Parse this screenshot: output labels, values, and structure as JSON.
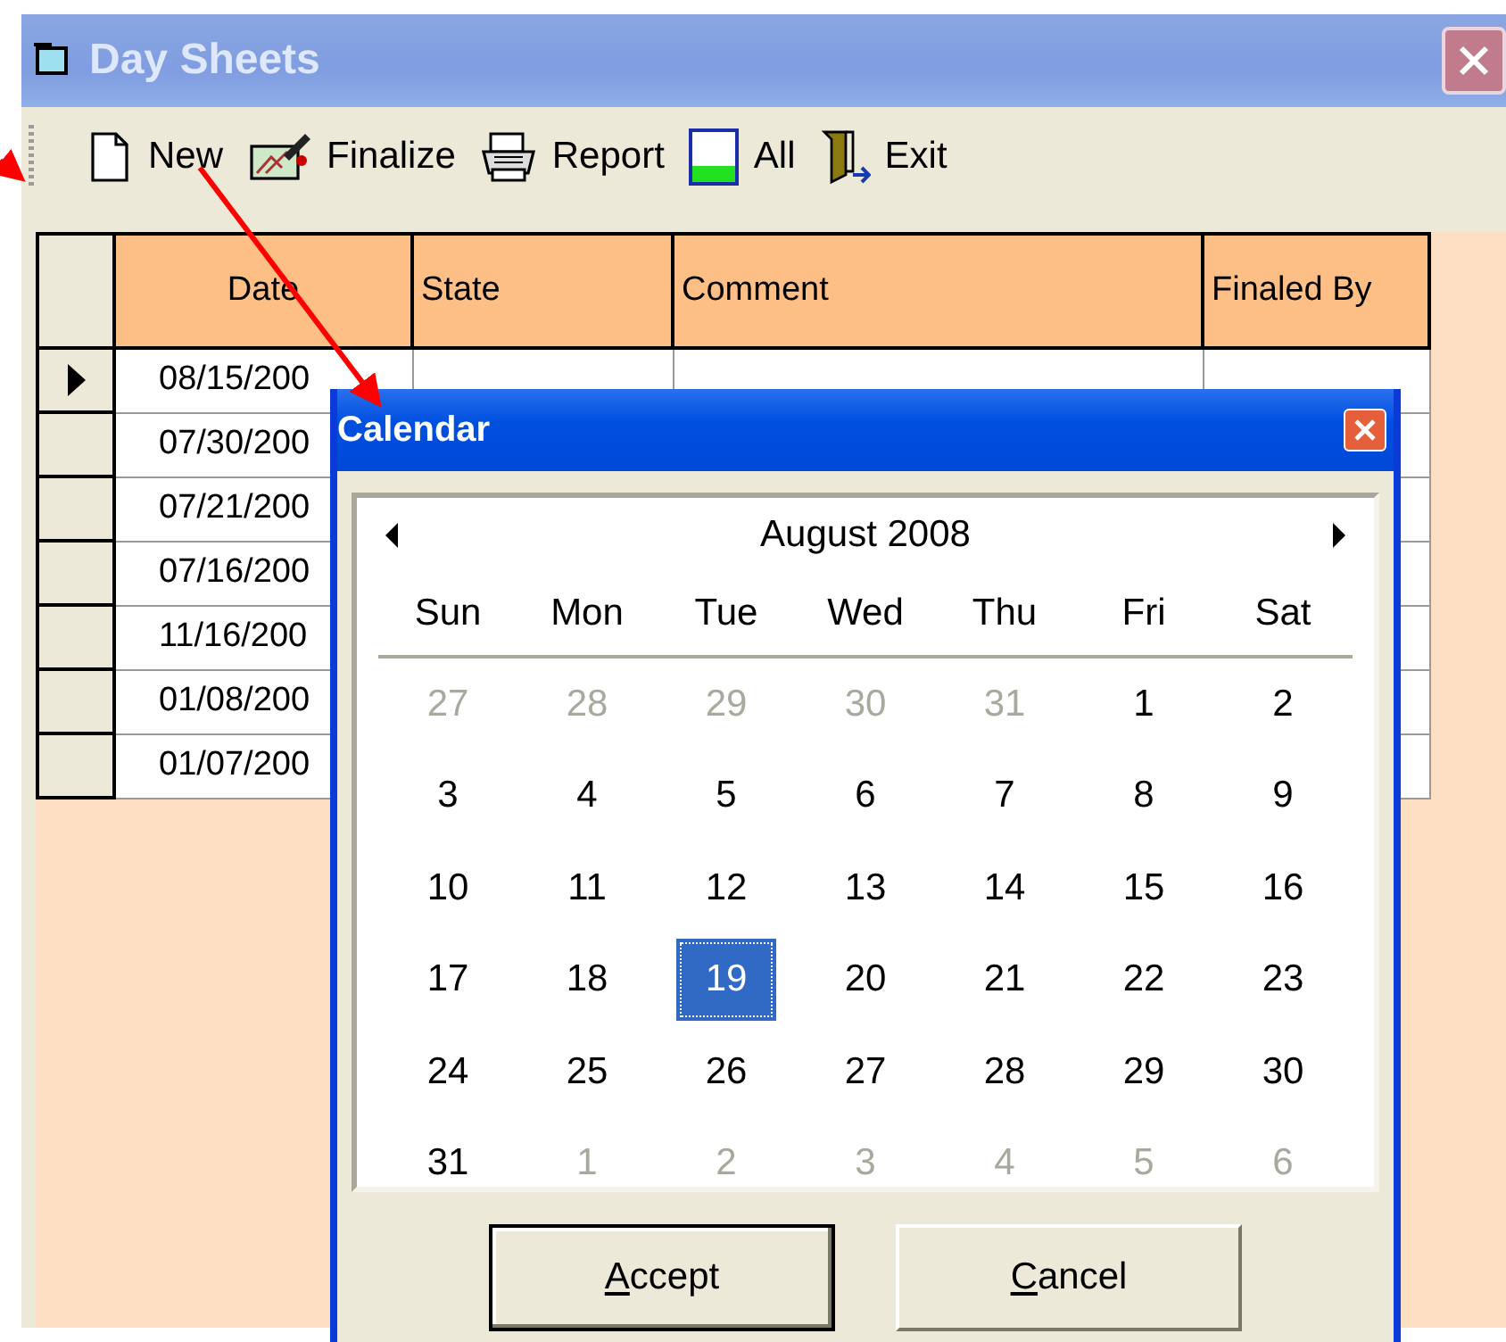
{
  "window": {
    "title": "Day Sheets"
  },
  "toolbar": [
    {
      "kind": "new",
      "label": "New"
    },
    {
      "kind": "finalize",
      "label": "Finalize"
    },
    {
      "kind": "report",
      "label": "Report"
    },
    {
      "kind": "all",
      "label": "All"
    },
    {
      "kind": "exit",
      "label": "Exit"
    }
  ],
  "grid": {
    "columns": [
      "Date",
      "State",
      "Comment",
      "Finaled By"
    ],
    "rows": [
      {
        "current": true,
        "date": "08/15/200"
      },
      {
        "current": false,
        "date": "07/30/200"
      },
      {
        "current": false,
        "date": "07/21/200"
      },
      {
        "current": false,
        "date": "07/16/200"
      },
      {
        "current": false,
        "date": "11/16/200"
      },
      {
        "current": false,
        "date": "01/08/200"
      },
      {
        "current": false,
        "date": "01/07/200"
      }
    ]
  },
  "calendar": {
    "title": "Calendar",
    "month": "August 2008",
    "weekdays": [
      "Sun",
      "Mon",
      "Tue",
      "Wed",
      "Thu",
      "Fri",
      "Sat"
    ],
    "weeks": [
      [
        {
          "day": "27",
          "muted": true,
          "selected": false
        },
        {
          "day": "28",
          "muted": true,
          "selected": false
        },
        {
          "day": "29",
          "muted": true,
          "selected": false
        },
        {
          "day": "30",
          "muted": true,
          "selected": false
        },
        {
          "day": "31",
          "muted": true,
          "selected": false
        },
        {
          "day": "1",
          "muted": false,
          "selected": false
        },
        {
          "day": "2",
          "muted": false,
          "selected": false
        }
      ],
      [
        {
          "day": "3",
          "muted": false,
          "selected": false
        },
        {
          "day": "4",
          "muted": false,
          "selected": false
        },
        {
          "day": "5",
          "muted": false,
          "selected": false
        },
        {
          "day": "6",
          "muted": false,
          "selected": false
        },
        {
          "day": "7",
          "muted": false,
          "selected": false
        },
        {
          "day": "8",
          "muted": false,
          "selected": false
        },
        {
          "day": "9",
          "muted": false,
          "selected": false
        }
      ],
      [
        {
          "day": "10",
          "muted": false,
          "selected": false
        },
        {
          "day": "11",
          "muted": false,
          "selected": false
        },
        {
          "day": "12",
          "muted": false,
          "selected": false
        },
        {
          "day": "13",
          "muted": false,
          "selected": false
        },
        {
          "day": "14",
          "muted": false,
          "selected": false
        },
        {
          "day": "15",
          "muted": false,
          "selected": false
        },
        {
          "day": "16",
          "muted": false,
          "selected": false
        }
      ],
      [
        {
          "day": "17",
          "muted": false,
          "selected": false
        },
        {
          "day": "18",
          "muted": false,
          "selected": false
        },
        {
          "day": "19",
          "muted": false,
          "selected": true
        },
        {
          "day": "20",
          "muted": false,
          "selected": false
        },
        {
          "day": "21",
          "muted": false,
          "selected": false
        },
        {
          "day": "22",
          "muted": false,
          "selected": false
        },
        {
          "day": "23",
          "muted": false,
          "selected": false
        }
      ],
      [
        {
          "day": "24",
          "muted": false,
          "selected": false
        },
        {
          "day": "25",
          "muted": false,
          "selected": false
        },
        {
          "day": "26",
          "muted": false,
          "selected": false
        },
        {
          "day": "27",
          "muted": false,
          "selected": false
        },
        {
          "day": "28",
          "muted": false,
          "selected": false
        },
        {
          "day": "29",
          "muted": false,
          "selected": false
        },
        {
          "day": "30",
          "muted": false,
          "selected": false
        }
      ],
      [
        {
          "day": "31",
          "muted": false,
          "selected": false
        },
        {
          "day": "1",
          "muted": true,
          "selected": false
        },
        {
          "day": "2",
          "muted": true,
          "selected": false
        },
        {
          "day": "3",
          "muted": true,
          "selected": false
        },
        {
          "day": "4",
          "muted": true,
          "selected": false
        },
        {
          "day": "5",
          "muted": true,
          "selected": false
        },
        {
          "day": "6",
          "muted": true,
          "selected": false
        }
      ]
    ],
    "buttons": [
      {
        "label": "Accept",
        "default": true
      },
      {
        "label": "Cancel",
        "default": false
      }
    ]
  }
}
